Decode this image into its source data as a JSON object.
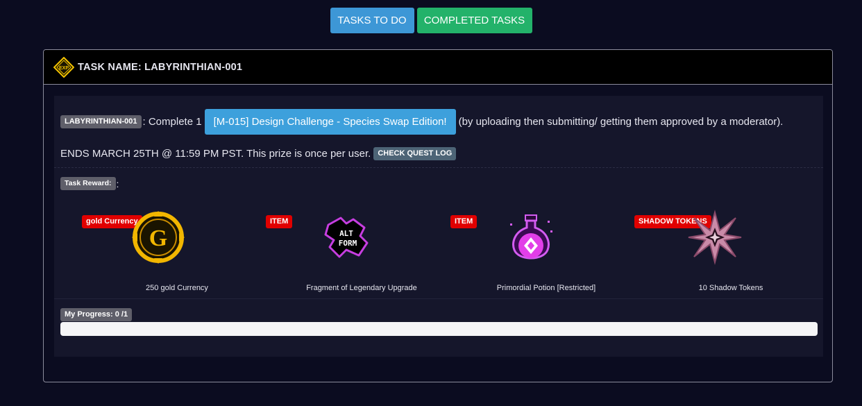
{
  "tabs": {
    "todo_label": "TASKS TO DO",
    "completed_label": "COMPLETED TASKS"
  },
  "task": {
    "header_title": "TASK NAME: LABYRINTHIAN-001",
    "header_icon_text": "EXP",
    "id_badge": "LABYRINTHIAN-001",
    "description_prefix": ": Complete 1",
    "quest_link": "[M-015] Design Challenge - Species Swap Edition!",
    "description_suffix": "(by uploading then submitting/ getting them approved by a moderator).",
    "ends_text": "ENDS MARCH 25TH @ 11:59 PM PST. This prize is once per user.",
    "quest_log_label": "CHECK QUEST LOG",
    "reward_label": "Task Reward:",
    "reward_colon": ":"
  },
  "rewards": [
    {
      "tag": "gold Currency",
      "name": "250 gold Currency",
      "icon": "gold-coin-icon"
    },
    {
      "tag": "ITEM",
      "name": "Fragment of Legendary Upgrade",
      "icon": "alt-form-puzzle-icon",
      "icon_text_1": "ALT",
      "icon_text_2": "FORM"
    },
    {
      "tag": "ITEM",
      "name": "Primordial Potion [Restricted]",
      "icon": "potion-icon"
    },
    {
      "tag": "SHADOW TOKENS",
      "name": "10 Shadow Tokens",
      "icon": "shadow-star-icon"
    }
  ],
  "progress": {
    "label": "My Progress: 0 /1",
    "fraction": 0
  },
  "colors": {
    "background": "#0b0c20",
    "todo_tab": "#3d97d6",
    "completed_tab": "#23b26a",
    "tag_red": "#e00000",
    "quest_button": "#3da0dc"
  }
}
